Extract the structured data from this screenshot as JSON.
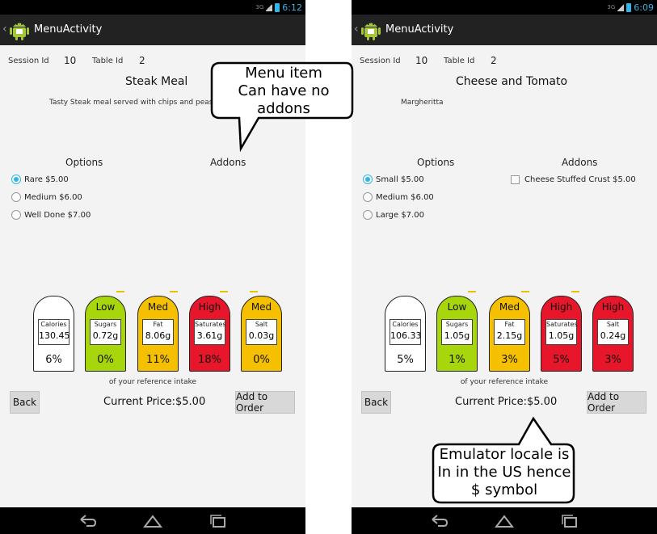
{
  "screens": [
    {
      "status_time": "6:12",
      "status_net": "3G",
      "title": "MenuActivity",
      "session_label": "Session Id",
      "session_value": "10",
      "table_label": "Table Id",
      "table_value": "2",
      "meal_title": "Steak Meal",
      "meal_desc": "Tasty Steak meal served with chips and peas",
      "options_label": "Options",
      "addons_label": "Addons",
      "options": [
        {
          "label": "Rare $5.00",
          "selected": true
        },
        {
          "label": "Medium $6.00",
          "selected": false
        },
        {
          "label": "Well Done $7.00",
          "selected": false
        }
      ],
      "addons": [],
      "nutrition": [
        {
          "level": "",
          "label": "Calories",
          "value": "130.45",
          "pct": "6%",
          "color": "#ffffff"
        },
        {
          "level": "Low",
          "label": "Sugars",
          "value": "0.72g",
          "pct": "0%",
          "color": "#a6d60b"
        },
        {
          "level": "Med",
          "label": "Fat",
          "value": "8.06g",
          "pct": "11%",
          "color": "#f5c000"
        },
        {
          "level": "High",
          "label": "Saturates",
          "value": "3.61g",
          "pct": "18%",
          "color": "#e8162a"
        },
        {
          "level": "Med",
          "label": "Salt",
          "value": "0.03g",
          "pct": "0%",
          "color": "#f5c000"
        }
      ],
      "ref_intake": "of your reference intake",
      "back_label": "Back",
      "price_label": "Current Price:",
      "price_value": "$5.00",
      "add_label": "Add to Order"
    },
    {
      "status_time": "6:09",
      "status_net": "3G",
      "title": "MenuActivity",
      "session_label": "Session Id",
      "session_value": "10",
      "table_label": "Table Id",
      "table_value": "2",
      "meal_title": "Cheese and Tomato",
      "meal_desc": "Margheritta",
      "options_label": "Options",
      "addons_label": "Addons",
      "options": [
        {
          "label": "Small $5.00",
          "selected": true
        },
        {
          "label": "Medium $6.00",
          "selected": false
        },
        {
          "label": "Large $7.00",
          "selected": false
        }
      ],
      "addons": [
        {
          "label": "Cheese Stuffed Crust $5.00",
          "checked": false
        }
      ],
      "nutrition": [
        {
          "level": "",
          "label": "Calories",
          "value": "106.33",
          "pct": "5%",
          "color": "#ffffff"
        },
        {
          "level": "Low",
          "label": "Sugars",
          "value": "1.05g",
          "pct": "1%",
          "color": "#a6d60b"
        },
        {
          "level": "Med",
          "label": "Fat",
          "value": "2.15g",
          "pct": "3%",
          "color": "#f5c000"
        },
        {
          "level": "High",
          "label": "Saturates",
          "value": "1.05g",
          "pct": "5%",
          "color": "#e8162a"
        },
        {
          "level": "High",
          "label": "Salt",
          "value": "0.24g",
          "pct": "3%",
          "color": "#e8162a"
        }
      ],
      "ref_intake": "of your reference intake",
      "back_label": "Back",
      "price_label": "Current Price:",
      "price_value": "$5.00",
      "add_label": "Add to Order"
    }
  ],
  "callouts": {
    "top": {
      "lines": [
        "Menu item",
        "Can have no",
        "addons"
      ]
    },
    "bottom": {
      "lines": [
        "Emulator locale is",
        "In in the US hence",
        "$ symbol"
      ]
    }
  }
}
